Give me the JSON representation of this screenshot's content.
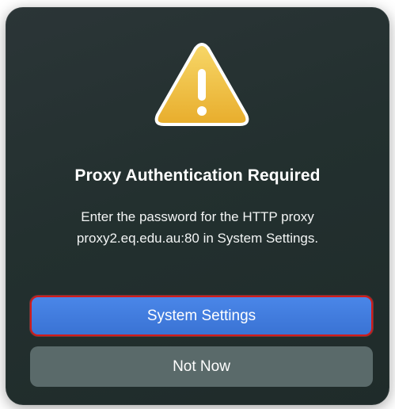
{
  "dialog": {
    "icon": "warning-triangle-icon",
    "title": "Proxy Authentication Required",
    "message_line1": "Enter the password for the HTTP proxy",
    "message_line2": "proxy2.eq.edu.au:80 in System Settings.",
    "primary_button_label": "System Settings",
    "secondary_button_label": "Not Now"
  },
  "colors": {
    "primary_button": "#3f7ce0",
    "primary_button_highlight_border": "#d21b1b",
    "secondary_button": "#5a6a6a",
    "warning_icon": "#f2c13b"
  }
}
